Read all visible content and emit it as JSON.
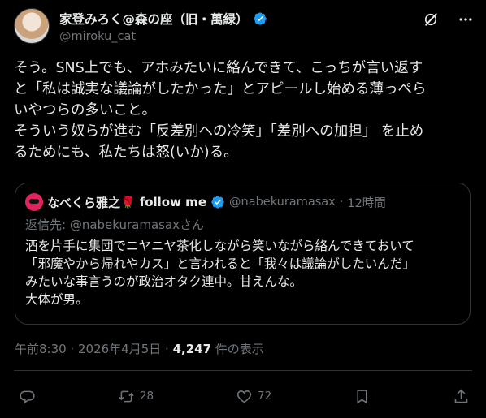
{
  "author": {
    "display_name": "家登みろく@森の座（旧・萬緑）",
    "handle": "@miroku_cat"
  },
  "post": {
    "lines": [
      "そう。SNS上でも、アホみたいに絡んできて、こっちが言い返す",
      "と「私は誠実な議論がしたかった」とアピールし始める薄っぺら",
      "いやつらの多いこと。",
      "そういう奴らが進む「反差別への冷笑」「差別への加担」 を止め",
      "るためにも、私たちは怒(いか)る。"
    ]
  },
  "quote": {
    "display_name": "なべくら雅之🌹",
    "follow_label": "follow me",
    "handle": "@nabekuramasax",
    "separator": "·",
    "time": "12時間",
    "reply_prefix": "返信先: ",
    "reply_handle": "@nabekuramasaxさん",
    "lines": [
      "酒を片手に集団でニヤニヤ茶化しながら笑いながら絡んできておいて",
      "「邪魔やから帰れやカス」と言われると「我々は議論がしたいんだ」",
      "みたいな事言うのが政治オタク連中。甘えんな。",
      "大体が男。"
    ]
  },
  "meta": {
    "timestamp": "午前8:30 · 2026年4月5日 · ",
    "views_count": "4,247",
    "views_label": " 件の表示"
  },
  "actions": {
    "retweets": "28",
    "likes": "72"
  },
  "colors": {
    "background": "#000000",
    "text": "#e7e9ea",
    "muted": "#71767b",
    "verified": "#1d9bf0",
    "border": "#2f3336"
  }
}
